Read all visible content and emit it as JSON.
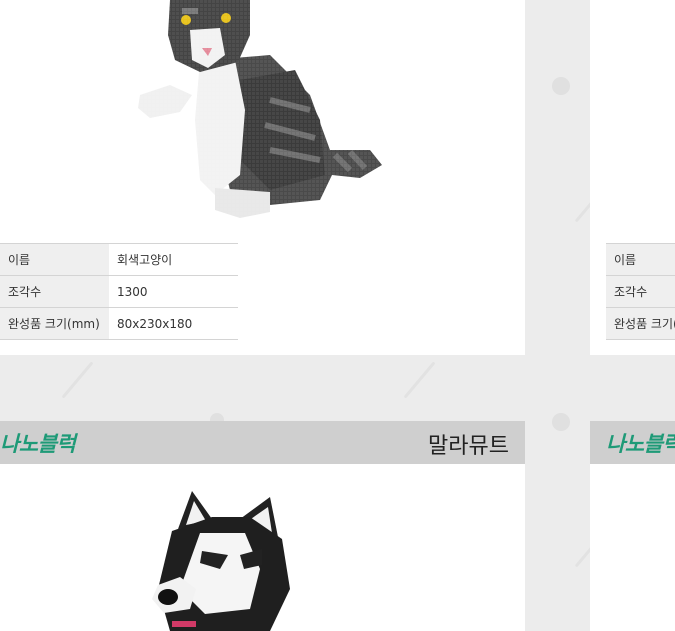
{
  "products": [
    {
      "position": "top-left",
      "name": "회색고양이",
      "specs": [
        {
          "label": "이름",
          "value": "회색고양이"
        },
        {
          "label": "조각수",
          "value": "1300"
        },
        {
          "label": "완성품 크기(mm)",
          "value": "80x230x180"
        }
      ]
    },
    {
      "position": "top-right",
      "specs": [
        {
          "label": "이름"
        },
        {
          "label": "조각수"
        },
        {
          "label": "완성품 크기(mm)"
        }
      ]
    },
    {
      "position": "bottom-left",
      "brand": "나노블럭",
      "title": "말라뮤트"
    },
    {
      "position": "bottom-right",
      "brand": "나노블럭"
    }
  ],
  "colors": {
    "brand": "#1e9a77",
    "header_bar": "#cfcfcf",
    "label_cell": "#efefef",
    "page_bg": "#ececec"
  },
  "icons": [
    "cat-figure-image",
    "husky-figure-image"
  ]
}
